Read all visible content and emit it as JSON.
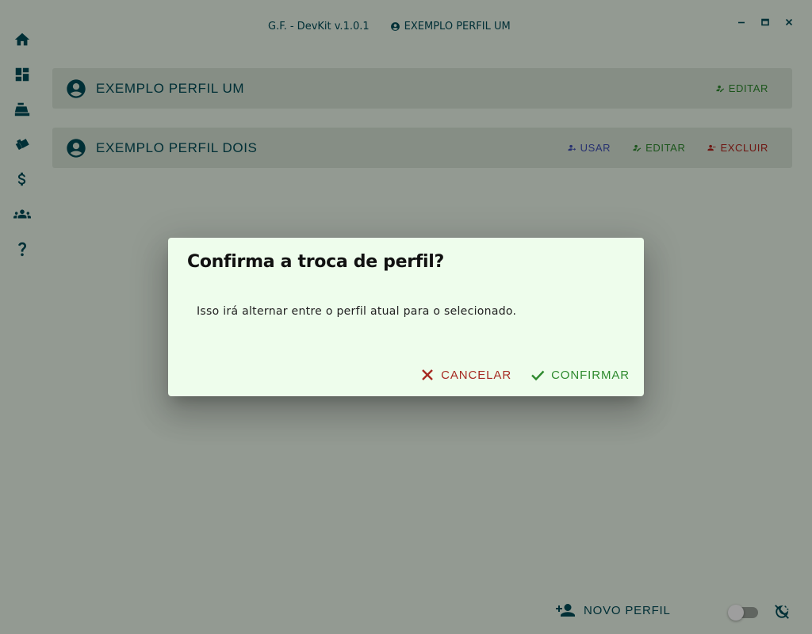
{
  "app": {
    "title": "G.F. - DevKit v.1.0.1",
    "active_profile": "EXEMPLO PERFIL UM"
  },
  "sidebar": {
    "items": [
      {
        "icon": "home-icon"
      },
      {
        "icon": "dashboard-icon"
      },
      {
        "icon": "cash-register-icon"
      },
      {
        "icon": "cards-icon"
      },
      {
        "icon": "dollar-icon"
      },
      {
        "icon": "people-icon"
      },
      {
        "icon": "help-icon"
      }
    ]
  },
  "window_controls": [
    "minimize",
    "maximize",
    "close"
  ],
  "profiles": [
    {
      "name": "EXEMPLO PERFIL UM",
      "actions": {
        "edit": "EDITAR"
      }
    },
    {
      "name": "EXEMPLO PERFIL DOIS",
      "actions": {
        "use": "USAR",
        "edit": "EDITAR",
        "delete": "EXCLUIR"
      }
    }
  ],
  "bottom": {
    "new_profile": "NOVO PERFIL",
    "theme_toggle_on": false
  },
  "dialog": {
    "title": "Confirma a troca de perfil?",
    "text": "Isso irá alternar entre o perfil atual para o selecionado.",
    "cancel": "CANCELAR",
    "confirm": "CONFIRMAR"
  },
  "colors": {
    "primary": "#004d57",
    "background": "#eef8ec",
    "card": "#d8e6d7",
    "use": "#3f4fb5",
    "edit": "#2e8a2e",
    "delete": "#b3261e",
    "dialog_bg": "#eefdec"
  }
}
